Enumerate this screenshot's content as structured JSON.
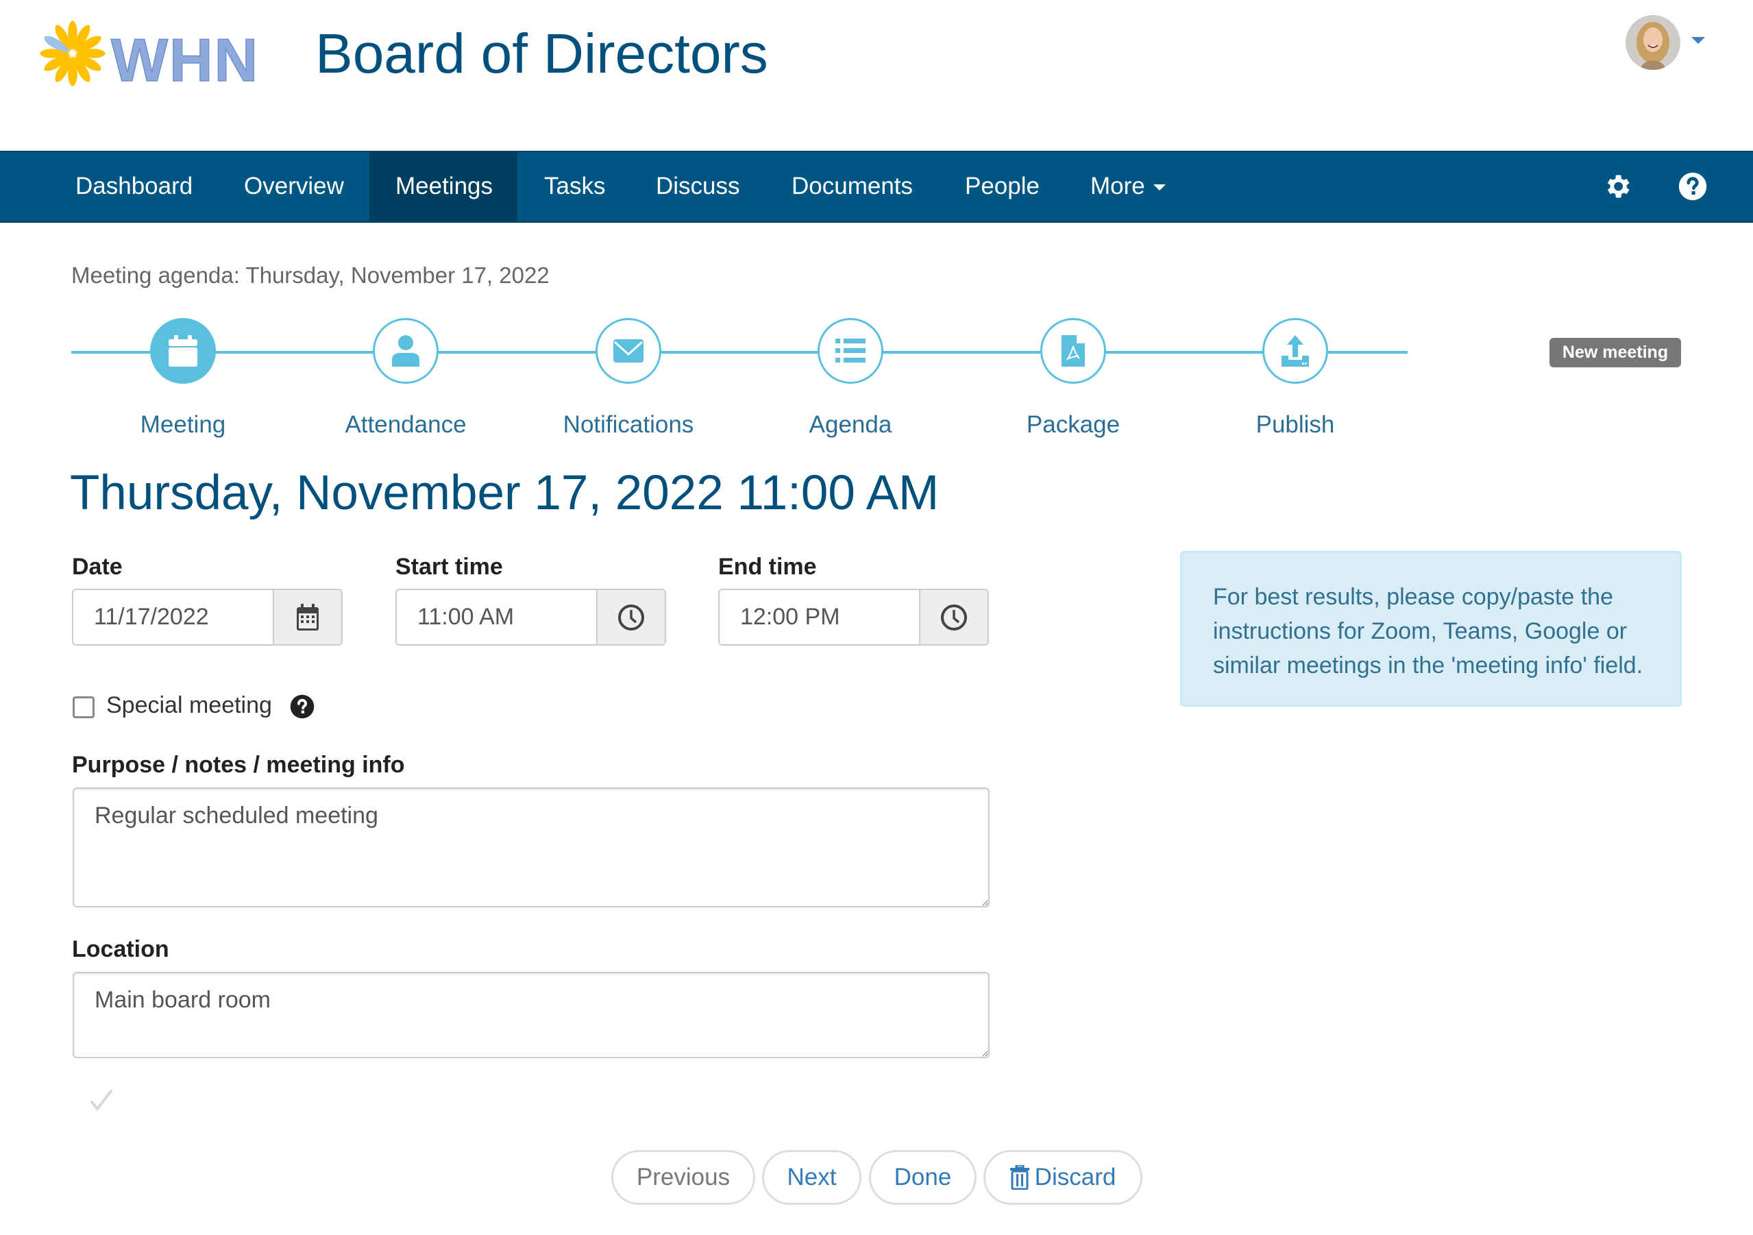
{
  "header": {
    "logo_text": "WHN",
    "title": "Board of Directors",
    "avatar_alt": "User avatar"
  },
  "nav": {
    "items": [
      {
        "label": "Dashboard",
        "active": false
      },
      {
        "label": "Overview",
        "active": false
      },
      {
        "label": "Meetings",
        "active": true
      },
      {
        "label": "Tasks",
        "active": false
      },
      {
        "label": "Discuss",
        "active": false
      },
      {
        "label": "Documents",
        "active": false
      },
      {
        "label": "People",
        "active": false
      },
      {
        "label": "More",
        "active": false,
        "dropdown": true
      }
    ],
    "icons": [
      "gear-icon",
      "help-icon"
    ]
  },
  "page": {
    "subtitle": "Meeting agenda: Thursday, November 17, 2022",
    "badge": "New meeting",
    "heading": "Thursday, November 17, 2022 11:00 AM"
  },
  "steps": [
    {
      "label": "Meeting",
      "icon": "calendar-icon",
      "active": true
    },
    {
      "label": "Attendance",
      "icon": "user-icon",
      "active": false
    },
    {
      "label": "Notifications",
      "icon": "envelope-icon",
      "active": false
    },
    {
      "label": "Agenda",
      "icon": "list-icon",
      "active": false
    },
    {
      "label": "Package",
      "icon": "pdf-file-icon",
      "active": false
    },
    {
      "label": "Publish",
      "icon": "upload-icon",
      "active": false
    }
  ],
  "form": {
    "date": {
      "label": "Date",
      "value": "11/17/2022"
    },
    "start_time": {
      "label": "Start time",
      "value": "11:00 AM"
    },
    "end_time": {
      "label": "End time",
      "value": "12:00 PM"
    },
    "special_meeting": {
      "label": "Special meeting",
      "checked": false
    },
    "purpose": {
      "label": "Purpose / notes / meeting info",
      "value": "Regular scheduled meeting"
    },
    "location": {
      "label": "Location",
      "value": "Main board room"
    }
  },
  "info": {
    "text": "For best results, please copy/paste the instructions for Zoom, Teams, Google or similar meetings in the 'meeting info' field."
  },
  "buttons": {
    "previous": "Previous",
    "next": "Next",
    "done": "Done",
    "discard": "Discard"
  },
  "colors": {
    "brand": "#005683",
    "brand_active": "#003e60",
    "title": "#00507e",
    "step_accent": "#5bc0de",
    "link": "#337ab7",
    "info_bg": "#d9edf7",
    "info_text": "#31708f",
    "badge_bg": "#777777",
    "logo_petal": "#ffc000",
    "logo_text": "#8eaadb"
  }
}
